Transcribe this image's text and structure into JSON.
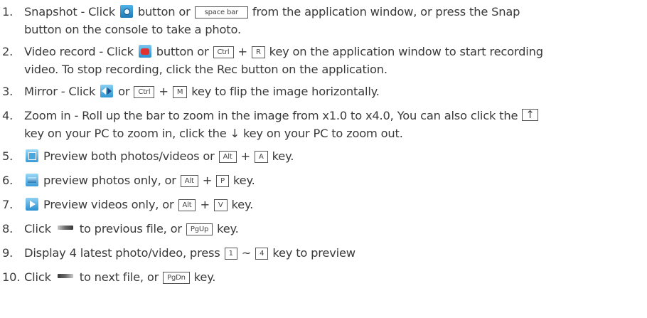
{
  "items": [
    {
      "num": "1.",
      "a": "Snapshot - Click",
      "icon": "camera-icon",
      "b": "button or",
      "key1": "space bar",
      "c": "from the application window, or press the Snap",
      "line2": "button on the console to take a photo."
    },
    {
      "num": "2.",
      "a": "Video record - Click",
      "icon": "record-icon",
      "b": "button or",
      "key1": "Ctrl",
      "plus": "+",
      "key2": "R",
      "c": "key on the application window to start recording",
      "line2": "video. To stop recording, click the Rec button on the application."
    },
    {
      "num": "3.",
      "a": "Mirror - Click",
      "icon": "mirror-icon",
      "b": "or",
      "key1": "Ctrl",
      "plus": "+",
      "key2": "M",
      "c": "key to flip the image horizontally."
    },
    {
      "num": "4.",
      "a": "Zoom in - Roll up the bar to zoom in the image from x1.0 to x4.0, You can also click the",
      "key1": "↑",
      "line2": "key on your PC to zoom in, click the ↓ key on your PC to zoom out."
    },
    {
      "num": "5.",
      "icon": "preview-both-icon",
      "a": "Preview both photos/videos or",
      "key1": "Alt",
      "plus": "+",
      "key2": "A",
      "c": "key."
    },
    {
      "num": "6.",
      "icon": "preview-photos-icon",
      "a": "preview photos only, or",
      "key1": "Alt",
      "plus": "+",
      "key2": "P",
      "c": "key."
    },
    {
      "num": "7.",
      "icon": "preview-videos-icon",
      "a": "Preview videos only, or",
      "key1": "Alt",
      "plus": "+",
      "key2": "V",
      "c": "key."
    },
    {
      "num": "8.",
      "a": "Click",
      "icon": "previous-file-icon",
      "b": "to previous file, or",
      "key1": "PgUp",
      "c": "key."
    },
    {
      "num": "9.",
      "a": "Display 4 latest photo/video, press",
      "key1": "1",
      "tilde": "~",
      "key2": "4",
      "c": "key to preview"
    },
    {
      "num": "10.",
      "a": "Click",
      "icon": "next-file-icon",
      "b": "to next file, or",
      "key1": "PgDn",
      "c": "key."
    }
  ],
  "colors": {
    "text": "#3a3a3a",
    "key_border": "#555555",
    "icon_blue": "#2b8fcf",
    "record_red": "#e53030"
  }
}
